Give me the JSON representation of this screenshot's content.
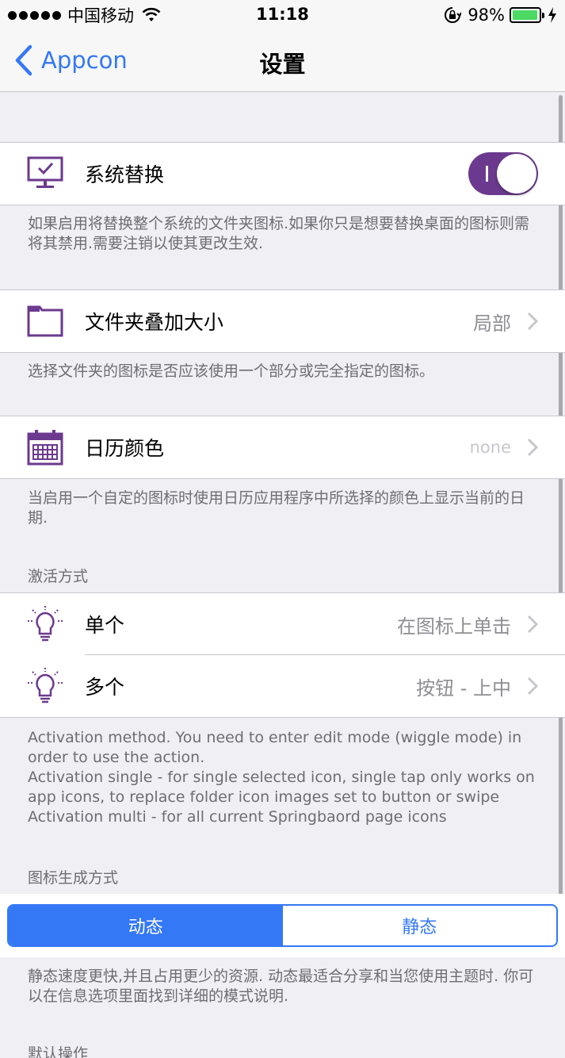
{
  "status_bar": {
    "carrier": "中国移动",
    "time": "11:18",
    "battery_percent": "98%",
    "battery_level": 0.98
  },
  "nav": {
    "back_label": "Appcon",
    "title": "设置"
  },
  "section_system": {
    "label": "系统替换",
    "toggle_on": true,
    "footer": "如果启用将替换整个系统的文件夹图标.如果你只是想要替换桌面的图标则需将其禁用.需要注销以使其更改生效."
  },
  "section_folder": {
    "label": "文件夹叠加大小",
    "value": "局部",
    "footer": "选择文件夹的图标是否应该使用一个部分或完全指定的图标。"
  },
  "section_calendar": {
    "label": "日历颜色",
    "value": "none",
    "footer": "当启用一个自定的图标时使用日历应用程序中所选择的颜色上显示当前的日期."
  },
  "section_activation": {
    "header": "激活方式",
    "items": [
      {
        "label": "单个",
        "value": "在图标上单击"
      },
      {
        "label": "多个",
        "value": "按钮 - 上中"
      }
    ],
    "footer_lines": [
      "Activation method. You need to enter edit mode (wiggle mode) in order to use the action.",
      "Activation single - for single selected icon, single tap only works on app icons, to replace folder icon images set to button or swipe",
      "Activation multi - for all current Springbaord page icons"
    ]
  },
  "section_generation": {
    "header": "图标生成方式",
    "segments": [
      "动态",
      "静态"
    ],
    "selected_index": 0,
    "footer": "静态速度更快,并且占用更少的资源. 动态最适合分享和当您使用主题时. 你可以在信息选项里面找到详细的模式说明."
  },
  "section_default": {
    "header": "默认操作"
  },
  "colors": {
    "accent": "#3478f6",
    "icon_purple": "#6b3a8e",
    "background": "#efeff4"
  },
  "icons": {
    "system": "monitor-check-icon",
    "folder": "folder-icon",
    "calendar": "calendar-icon",
    "bulb": "lightbulb-icon"
  }
}
